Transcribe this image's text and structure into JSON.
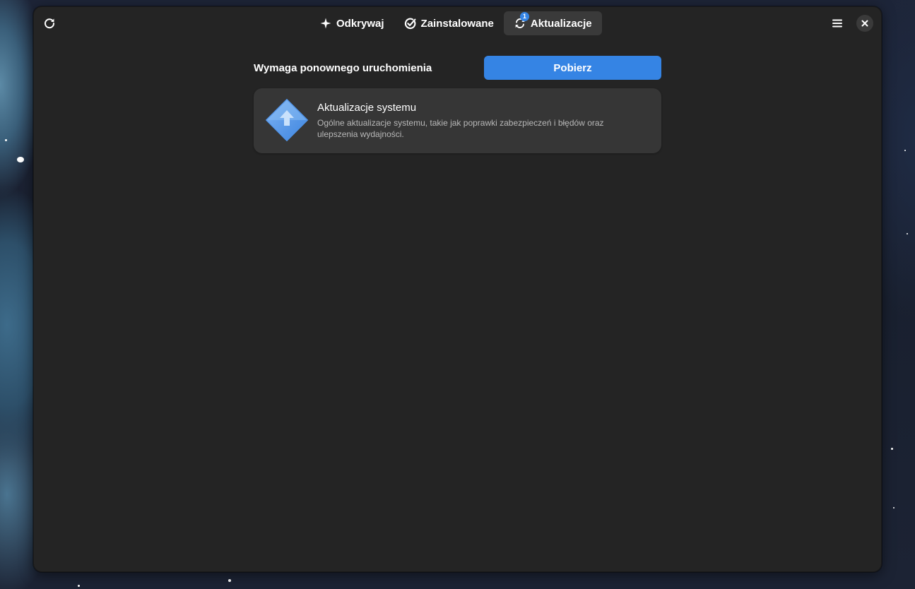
{
  "window": {
    "accent": "#3584e4",
    "background": "#242424"
  },
  "header": {
    "refresh_icon": "view-refresh-icon",
    "menu_icon": "hamburger-menu-icon",
    "close_icon": "close-icon",
    "tabs": [
      {
        "label": "Odkrywaj",
        "icon": "sparkle-icon",
        "active": false
      },
      {
        "label": "Zainstalowane",
        "icon": "checkmark-circle-icon",
        "active": false
      },
      {
        "label": "Aktualizacje",
        "icon": "sync-arrows-icon",
        "active": true,
        "badge": "1"
      }
    ]
  },
  "updates": {
    "section_title": "Wymaga ponownego uruchomienia",
    "download_label": "Pobierz",
    "items": [
      {
        "title": "Aktualizacje systemu",
        "description": "Ogólne aktualizacje systemu, takie jak poprawki zabezpieczeń i błędów oraz ulepszenia wydajności.",
        "icon": "system-update-diamond-icon"
      }
    ]
  }
}
